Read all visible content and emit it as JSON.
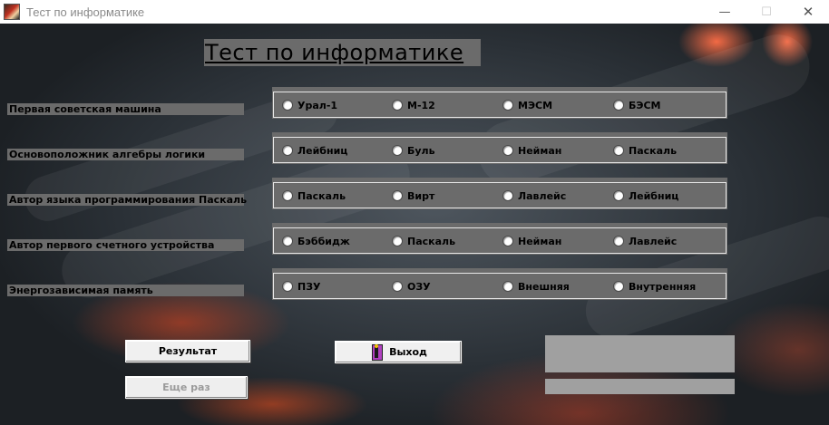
{
  "window": {
    "title": "Тест по информатике",
    "controls": {
      "minimize": "—",
      "maximize": "☐",
      "close": "✕"
    }
  },
  "heading": "Тест по информатике",
  "questions": [
    {
      "label": "Первая советская машина",
      "options": [
        "Урал-1",
        "М-12",
        "МЭСМ",
        "БЭСМ"
      ]
    },
    {
      "label": "Основоположник алгебры логики",
      "options": [
        "Лейбниц",
        "Буль",
        "Нейман",
        "Паскаль"
      ]
    },
    {
      "label": "Автор языка программирования Паскаль",
      "options": [
        "Паскаль",
        "Вирт",
        "Лавлейс",
        "Лейбниц"
      ]
    },
    {
      "label": "Автор первого счетного устройства",
      "options": [
        "Бэббидж",
        "Паскаль",
        "Нейман",
        "Лавлейс"
      ]
    },
    {
      "label": "Энергозависимая память",
      "options": [
        "ПЗУ",
        "ОЗУ",
        "Внешняя",
        "Внутренняя"
      ]
    }
  ],
  "buttons": {
    "result": "Результат",
    "again": "Еще раз",
    "exit": "Выход"
  },
  "result": {
    "score": "",
    "message": ""
  },
  "icons": {
    "app": "app-icon",
    "exit": "exit-door-icon",
    "radio": "radio-button"
  }
}
